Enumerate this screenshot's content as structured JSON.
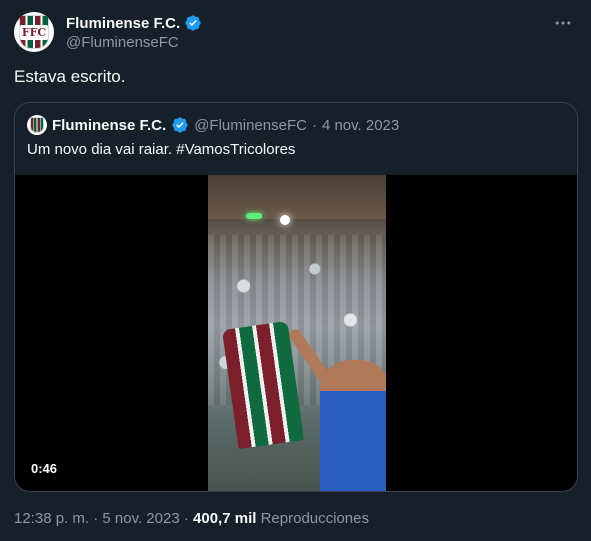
{
  "tweet": {
    "author": {
      "display_name": "Fluminense F.C.",
      "handle": "@FluminenseFC",
      "avatar_icon": "fluminense-crest-icon",
      "avatar_letters": "FFC",
      "verified_icon": "verified-badge-icon"
    },
    "more_icon": "more-options-icon",
    "text": "Estava escrito.",
    "timestamp": "12:38 p. m.",
    "separator": "·",
    "date": "5 nov. 2023",
    "views_count": "400,7 mil",
    "views_label": "Reproducciones"
  },
  "quoted_tweet": {
    "author": {
      "display_name": "Fluminense F.C.",
      "handle": "@FluminenseFC",
      "verified_icon": "verified-badge-icon"
    },
    "separator": "·",
    "date": "4 nov. 2023",
    "text": "Um novo dia vai raiar. #VamosTricolores",
    "video": {
      "duration": "0:46"
    }
  },
  "colors": {
    "background": "#15202b",
    "text_primary": "#f7f9f9",
    "text_secondary": "#8b98a5",
    "border": "#38444d",
    "verified": "#1d9bf0"
  }
}
